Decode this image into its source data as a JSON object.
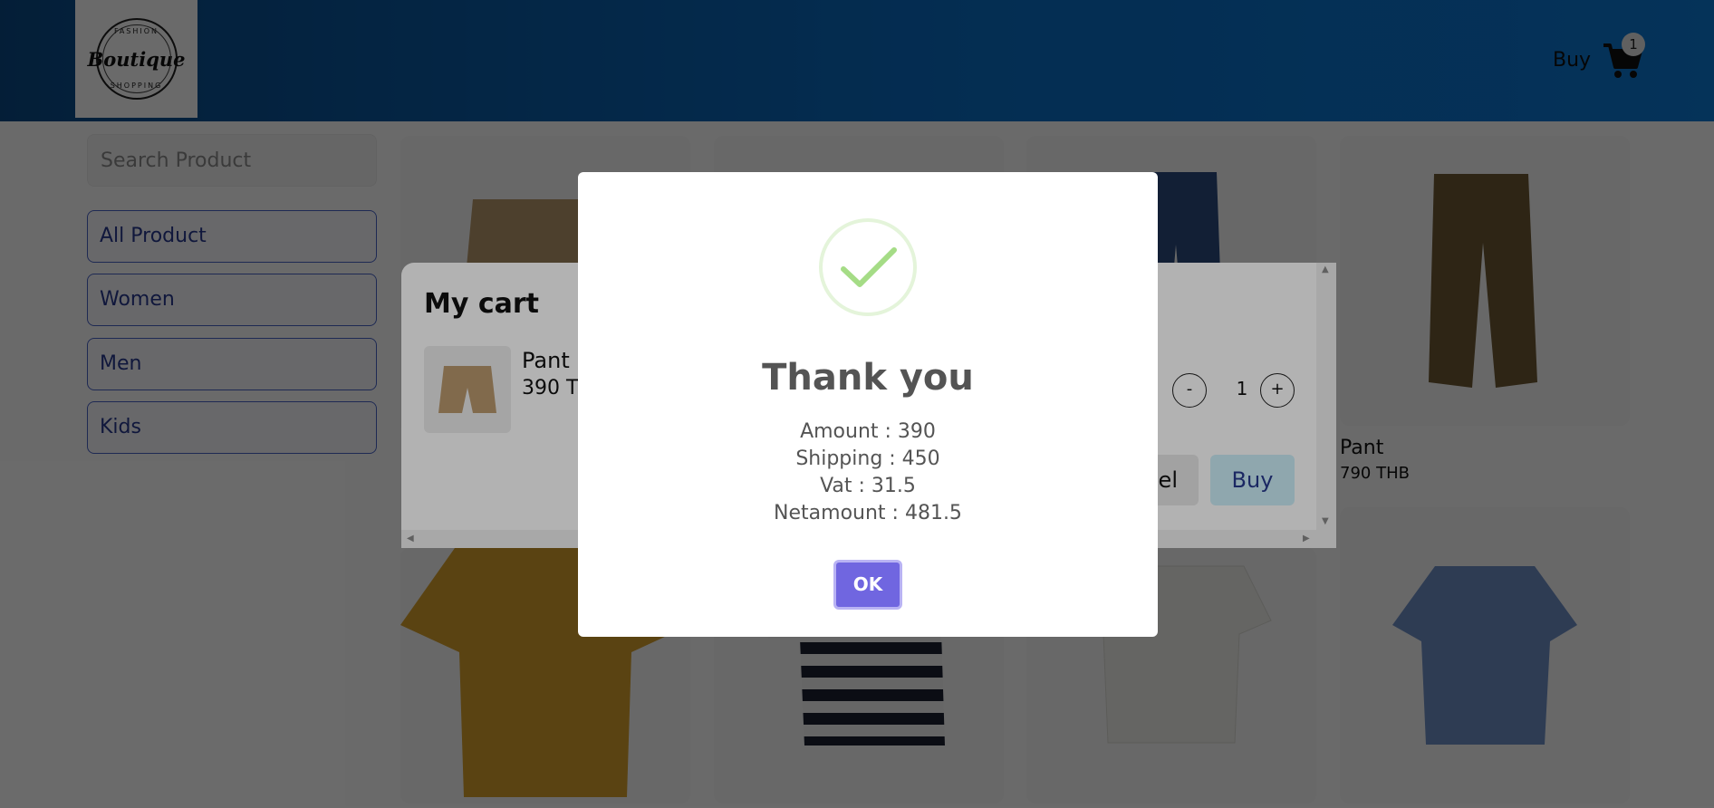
{
  "header": {
    "logo": {
      "top_text": "FASHION",
      "script_text": "Boutique",
      "bottom_text": "SHOPPING"
    },
    "buy_label": "Buy",
    "cart_icon": "shopping-cart-icon",
    "cart_count": "1"
  },
  "sidebar": {
    "search_placeholder": "Search Product",
    "categories": [
      {
        "label": "All Product"
      },
      {
        "label": "Women"
      },
      {
        "label": "Men"
      },
      {
        "label": "Kids"
      }
    ]
  },
  "products": [
    {
      "name": "Pant",
      "price": "790 THB"
    }
  ],
  "cart": {
    "title": "My cart",
    "item": {
      "name": "Pant",
      "price": "390 THB",
      "quantity": "1"
    },
    "minus_label": "-",
    "plus_label": "+",
    "cancel_label": "Cancel",
    "buy_label": "Buy"
  },
  "alert": {
    "icon": "success-check-icon",
    "title": "Thank you",
    "lines": [
      "Amount : 390",
      "Shipping : 450",
      "Vat : 31.5",
      "Netamount : 481.5"
    ],
    "ok_label": "OK"
  },
  "colors": {
    "header": "#0d6dc4",
    "category_border": "#4a64c7",
    "ok_button": "#7066e0",
    "success": "#a5dc86"
  }
}
